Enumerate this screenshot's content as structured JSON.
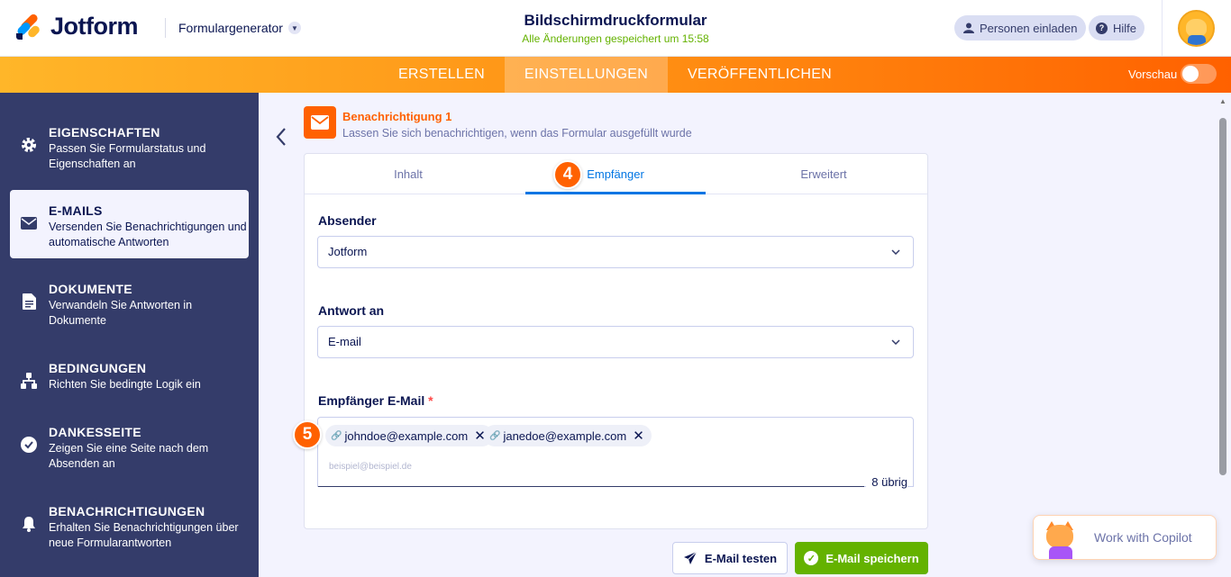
{
  "app": {
    "brand": "Jotform",
    "menu_label": "Formulargenerator"
  },
  "header": {
    "title": "Bildschirmdruckformular",
    "saved_status": "Alle Änderungen gespeichert um 15:58",
    "invite_label": "Personen einladen",
    "help_label": "Hilfe"
  },
  "nav": {
    "tabs": [
      {
        "label": "ERSTELLEN",
        "active": false
      },
      {
        "label": "EINSTELLUNGEN",
        "active": true
      },
      {
        "label": "VERÖFFENTLICHEN",
        "active": false
      }
    ],
    "preview_label": "Vorschau",
    "preview_on": false
  },
  "sidebar": {
    "items": [
      {
        "title": "EIGENSCHAFTEN",
        "desc": "Passen Sie Formularstatus und Eigenschaften an",
        "icon": "gear-icon"
      },
      {
        "title": "E-MAILS",
        "desc": "Versenden Sie Benachrichtigungen und automatische Antworten",
        "icon": "envelope-icon",
        "active": true
      },
      {
        "title": "DOKUMENTE",
        "desc": "Verwandeln Sie Antworten in Dokumente",
        "icon": "document-icon"
      },
      {
        "title": "BEDINGUNGEN",
        "desc": "Richten Sie bedingte Logik ein",
        "icon": "hierarchy-icon"
      },
      {
        "title": "DANKESSEITE",
        "desc": "Zeigen Sie eine Seite nach dem Absenden an",
        "icon": "check-circle-icon"
      },
      {
        "title": "BENACHRICHTIGUNGEN",
        "desc": "Erhalten Sie Benachrichtigungen über neue Formularantworten",
        "icon": "bell-icon"
      }
    ]
  },
  "notification": {
    "title": "Benachrichtigung 1",
    "subtitle": "Lassen Sie sich benachrichtigen, wenn das Formular ausgefüllt wurde"
  },
  "tabs": [
    {
      "label": "Inhalt",
      "active": false
    },
    {
      "label": "Empfänger",
      "active": true
    },
    {
      "label": "Erweitert",
      "active": false
    }
  ],
  "form": {
    "sender_label": "Absender",
    "sender_value": "Jotform",
    "reply_label": "Antwort an",
    "reply_value": "E-mail",
    "recipient_label": "Empfänger E-Mail",
    "required_mark": "*",
    "recipients": [
      "johndoe@example.com",
      "janedoe@example.com"
    ],
    "recipient_placeholder": "beispiel@beispiel.de",
    "remaining": "8 übrig"
  },
  "steps": {
    "tab_step": "4",
    "email_step": "5"
  },
  "buttons": {
    "test": "E-Mail testen",
    "save": "E-Mail speichern"
  },
  "copilot": {
    "label": "Work with Copilot"
  },
  "colors": {
    "accent": "#ff6100",
    "primary_blue": "#0075e3",
    "success": "#64b200",
    "sidebar": "#343c6a"
  }
}
